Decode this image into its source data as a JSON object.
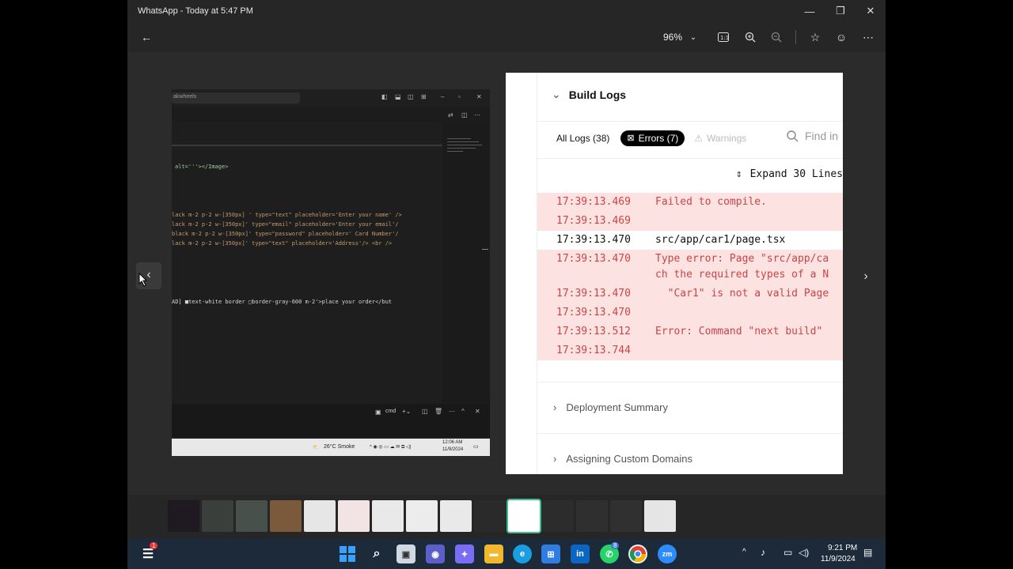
{
  "window": {
    "title": "WhatsApp - Today at 5:47 PM",
    "zoom": "96%"
  },
  "left_shot": {
    "search_text": "akwheels",
    "code_lines": [
      "alt='''></Image>",
      "lack m-2 p-2 w-[350px] ' type=\"text\" placeholder='Enter your name' />",
      "lack m-2 p-2 w-[350px]' type=\"email\"  placeholder='Enter your email'/",
      "black m-2 p-2 w-[350px]' type=\"password\" placeholder=' Card Number'/",
      "lack m-2 p-2 w-[350px]' type=\"text\" placeholder='Address'/> <br />",
      "AD] ■text-white border □border-gray-600 m-2'>place your order</but"
    ],
    "terminal_label": "cmd",
    "weather": "26°C Smoke",
    "clock_time": "12:06 AM",
    "clock_date": "11/9/2024"
  },
  "right_shot": {
    "header": "Build Logs",
    "tabs": {
      "all": "All Logs (38)",
      "errors": "Errors (7)",
      "warnings": "Warnings",
      "find": "Find in"
    },
    "expand": "Expand 30 Lines",
    "logs": [
      {
        "time": "17:39:13.469",
        "msg": "Failed to compile.",
        "kind": "red"
      },
      {
        "time": "17:39:13.469",
        "msg": "",
        "kind": "red"
      },
      {
        "time": "17:39:13.470",
        "msg": "src/app/car1/page.tsx",
        "kind": "white"
      },
      {
        "time": "17:39:13.470",
        "msg": "Type error: Page \"src/app/ca\nch the required types of a N",
        "kind": "red"
      },
      {
        "time": "17:39:13.470",
        "msg": "  \"Car1\" is not a valid Page",
        "kind": "red"
      },
      {
        "time": "17:39:13.470",
        "msg": "",
        "kind": "red"
      },
      {
        "time": "17:39:13.512",
        "msg": "Error: Command \"next build\"",
        "kind": "red"
      },
      {
        "time": "17:39:13.744",
        "msg": "",
        "kind": "red"
      }
    ],
    "sections": [
      "Deployment Summary",
      "Assigning Custom Domains"
    ]
  },
  "taskbar": {
    "time": "9:21 PM",
    "date": "11/9/2024",
    "whatsapp_badge": "8",
    "notif_badge": "1",
    "linkedin": "in",
    "zoom_app": "zm"
  },
  "colors": {
    "error_bg": "#fde2e2",
    "error_text": "#c44444",
    "active_thumb": "#3fbf8f"
  }
}
